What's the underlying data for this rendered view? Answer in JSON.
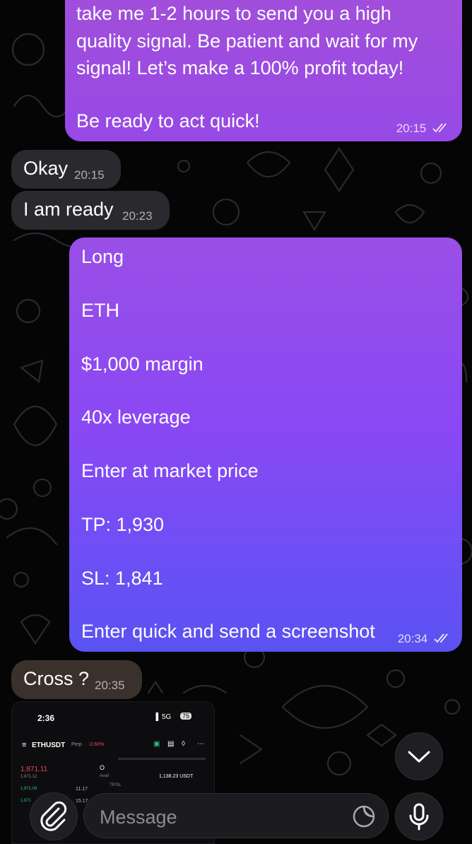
{
  "messages": [
    {
      "direction": "outgoing",
      "lines": [
        "take me 1-2 hours to send you a high",
        "quality signal. Be patient and wait for my",
        "signal! Let’s make a 100% profit today!",
        "",
        "Be ready to act quick!"
      ],
      "time": "20:15",
      "status": "read"
    },
    {
      "direction": "incoming",
      "text": "Okay",
      "time": "20:15"
    },
    {
      "direction": "incoming",
      "text": "I am ready",
      "time": "20:23"
    },
    {
      "direction": "outgoing",
      "lines": [
        "Long",
        "ETH",
        "$1,000 margin",
        "40x leverage",
        "Enter at market price",
        "TP: 1,930",
        "SL: 1,841",
        "Enter quick and send a screenshot"
      ],
      "time": "20:34",
      "status": "read"
    },
    {
      "direction": "incoming",
      "text": "Cross ?",
      "time": "20:35"
    }
  ],
  "screenshot": {
    "clock": "2:36",
    "network": "5G",
    "battery": "75",
    "pair": "ETHUSDT",
    "pair_type": "Perp",
    "change": "-2.60%",
    "price": "1,871.11",
    "sub_price": "1,871.12",
    "option_label": "O",
    "avail_label": "Avail",
    "avail_value": "1,138.23 USDT",
    "tpsl_label": "TP/SL",
    "book_prices": [
      "1,871.09",
      "1,871"
    ],
    "book_sizes": [
      "11.17",
      "15.17"
    ]
  },
  "input": {
    "placeholder": "Message"
  },
  "icons": {
    "attach": "paperclip-icon",
    "sticker": "sticker-icon",
    "mic": "microphone-icon",
    "scroll": "chevron-down-icon"
  },
  "colors": {
    "background": "#050506",
    "outgoing_top": "#9a4fe6",
    "outgoing_bottom": "#5a52f2",
    "incoming": "#2a2a2e",
    "negative": "#f0465c",
    "positive": "#2ebd85"
  }
}
